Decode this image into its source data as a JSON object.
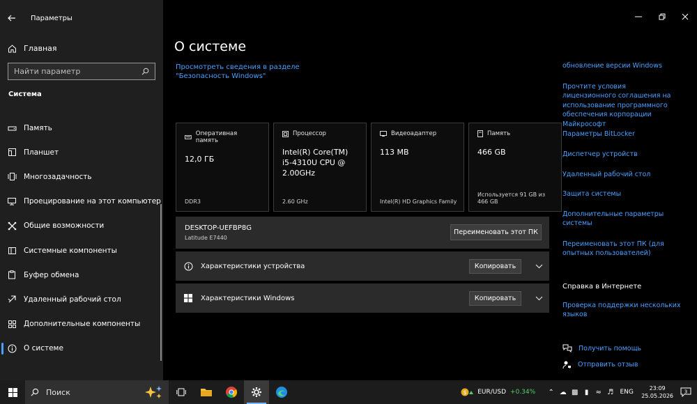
{
  "window": {
    "title": "Параметры"
  },
  "sidebar": {
    "home_label": "Главная",
    "search_placeholder": "Найти параметр",
    "section": "Система",
    "items": [
      {
        "label": "Память",
        "icon": "storage-icon"
      },
      {
        "label": "Планшет",
        "icon": "tablet-icon"
      },
      {
        "label": "Многозадачность",
        "icon": "multitasking-icon"
      },
      {
        "label": "Проецирование на этот компьютер",
        "icon": "projecting-icon"
      },
      {
        "label": "Общие возможности",
        "icon": "shared-experiences-icon"
      },
      {
        "label": "Системные компоненты",
        "icon": "system-components-icon"
      },
      {
        "label": "Буфер обмена",
        "icon": "clipboard-icon"
      },
      {
        "label": "Удаленный рабочий стол",
        "icon": "remote-desktop-icon"
      },
      {
        "label": "Дополнительные компоненты",
        "icon": "optional-features-icon"
      },
      {
        "label": "О системе",
        "icon": "info-icon",
        "active": true
      }
    ]
  },
  "main": {
    "title": "О системе",
    "security_link": "Просмотреть сведения в разделе \"Безопасность Windows\"",
    "specs": [
      {
        "label": "Оперативная память",
        "value": "12,0 ГБ",
        "sub": "DDR3",
        "icon": "ram-icon"
      },
      {
        "label": "Процессор",
        "value": "Intel(R) Core(TM) i5-4310U CPU @ 2.00GHz",
        "sub": "2.60 GHz",
        "icon": "cpu-icon"
      },
      {
        "label": "Видеоадаптер",
        "value": "113 MB",
        "sub": "Intel(R) HD Graphics Family",
        "icon": "gpu-icon"
      },
      {
        "label": "Память",
        "value": "466 GB",
        "sub": "Используется 91 GB из 466 GB",
        "icon": "disk-icon"
      }
    ],
    "pc": {
      "name": "DESKTOP-UEFBP8G",
      "model": "Latitude E7440",
      "rename_label": "Переименовать этот ПК"
    },
    "device_specs": {
      "label": "Характеристики устройства",
      "copy_label": "Копировать"
    },
    "windows_specs": {
      "label": "Характеристики Windows",
      "copy_label": "Копировать"
    }
  },
  "related": {
    "links": [
      "обновление версии Windows",
      "Прочтите условия лицензионного соглашения на использование программного обеспечения корпорации Майкрософт",
      "Параметры BitLocker",
      "Диспетчер устройств",
      "Удаленный рабочий стол",
      "Защита системы",
      "Дополнительные параметры системы",
      "Переименовать этот ПК (для опытных пользователей)"
    ],
    "web_help_title": "Справка в Интернете",
    "web_help_link": "Проверка поддержки нескольких языков",
    "get_help": "Получить помощь",
    "feedback": "Отправить отзыв"
  },
  "taskbar": {
    "search_placeholder": "Поиск",
    "ticker_name": "EUR/USD",
    "ticker_change": "+0.34%",
    "lang": "ENG",
    "time": "23:09",
    "date": "25.05.2026",
    "notifications": "3"
  },
  "colors": {
    "accent": "#4aa0ff",
    "panel": "#2b2b2b",
    "sidebar": "#1f1f1f",
    "positive": "#4fd06a"
  }
}
